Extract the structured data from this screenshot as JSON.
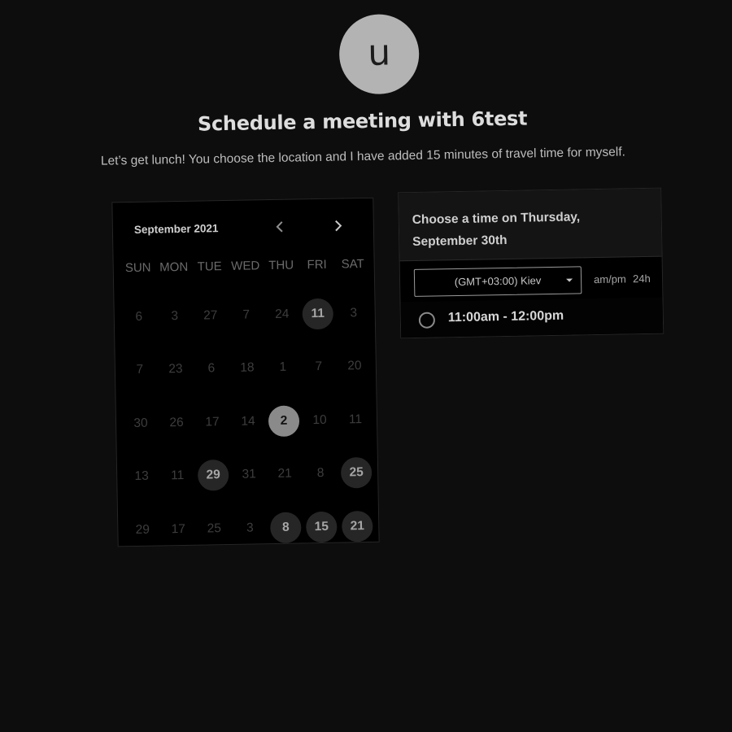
{
  "host": {
    "avatar_letter": "u",
    "title": "Schedule a meeting with 6test",
    "description": "Let’s get lunch! You choose the location and I have added 15 minutes of travel time for myself."
  },
  "calendar": {
    "month_label": "September 2021",
    "prev_icon": "chevron-left-icon",
    "next_icon": "chevron-right-icon",
    "weekdays": [
      "SUN",
      "MON",
      "TUE",
      "WED",
      "THU",
      "FRI",
      "SAT"
    ],
    "days": [
      {
        "label": "6",
        "state": "disabled"
      },
      {
        "label": "3",
        "state": "disabled"
      },
      {
        "label": "27",
        "state": "disabled"
      },
      {
        "label": "7",
        "state": "disabled"
      },
      {
        "label": "24",
        "state": "disabled"
      },
      {
        "label": "11",
        "state": "available"
      },
      {
        "label": "3",
        "state": "disabled"
      },
      {
        "label": "7",
        "state": "disabled"
      },
      {
        "label": "23",
        "state": "disabled"
      },
      {
        "label": "6",
        "state": "disabled"
      },
      {
        "label": "18",
        "state": "disabled"
      },
      {
        "label": "1",
        "state": "disabled"
      },
      {
        "label": "7",
        "state": "disabled"
      },
      {
        "label": "20",
        "state": "disabled"
      },
      {
        "label": "30",
        "state": "disabled"
      },
      {
        "label": "26",
        "state": "disabled"
      },
      {
        "label": "17",
        "state": "disabled"
      },
      {
        "label": "14",
        "state": "disabled"
      },
      {
        "label": "2",
        "state": "selected"
      },
      {
        "label": "10",
        "state": "disabled"
      },
      {
        "label": "11",
        "state": "disabled"
      },
      {
        "label": "13",
        "state": "disabled"
      },
      {
        "label": "11",
        "state": "disabled"
      },
      {
        "label": "29",
        "state": "available"
      },
      {
        "label": "31",
        "state": "disabled"
      },
      {
        "label": "21",
        "state": "disabled"
      },
      {
        "label": "8",
        "state": "disabled"
      },
      {
        "label": "25",
        "state": "available"
      },
      {
        "label": "29",
        "state": "disabled"
      },
      {
        "label": "17",
        "state": "disabled"
      },
      {
        "label": "25",
        "state": "disabled"
      },
      {
        "label": "3",
        "state": "disabled"
      },
      {
        "label": "8",
        "state": "available"
      },
      {
        "label": "15",
        "state": "available"
      },
      {
        "label": "21",
        "state": "available"
      }
    ]
  },
  "times": {
    "heading": "Choose a time on Thursday, September 30th",
    "timezone": "(GMT+03:00) Kiev",
    "format_ampm": "am/pm",
    "format_24h": "24h",
    "slots": [
      {
        "label": "11:00am - 12:00pm"
      }
    ]
  },
  "colors": {
    "background": "#0d0d0d",
    "available_day": "#262626",
    "selected_day": "#8a8a8a"
  }
}
